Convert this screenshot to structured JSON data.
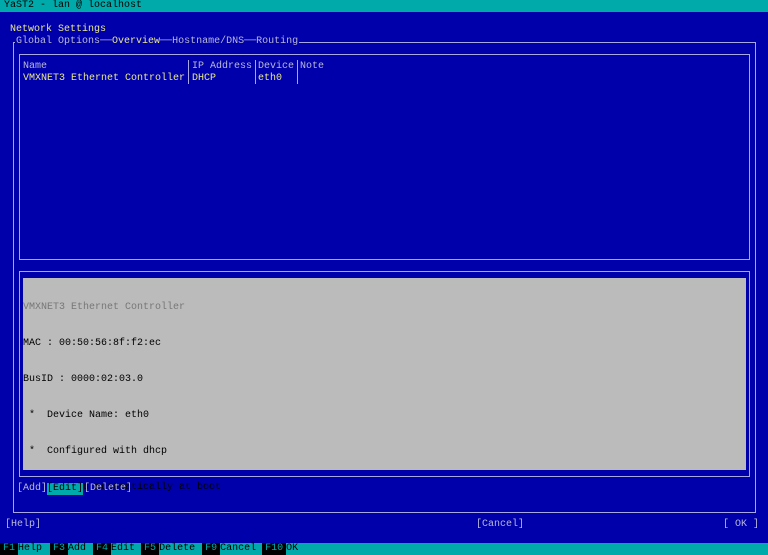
{
  "window_title": "YaST2 - lan @ localhost",
  "dialog_title": "Network Settings",
  "tabs": [
    {
      "label": "Global Options",
      "active": false
    },
    {
      "label": "Overview",
      "active": true
    },
    {
      "label": "Hostname/DNS",
      "active": false
    },
    {
      "label": "Routing",
      "active": false
    }
  ],
  "table": {
    "columns": [
      "Name",
      "IP Address",
      "Device",
      "Note"
    ],
    "rows": [
      [
        "VMXNET3 Ethernet Controller",
        "DHCP",
        "eth0",
        ""
      ]
    ]
  },
  "details": {
    "title": "VMXNET3 Ethernet Controller",
    "mac": "MAC : 00:50:56:8f:f2:ec",
    "busid": "BusID : 0000:02:03.0",
    "bullets": [
      "Device Name: eth0",
      "Configured with dhcp",
      "Started automatically at boot"
    ]
  },
  "buttons": {
    "add": "[Add]",
    "edit": "[Edit]",
    "delete": "[Delete]",
    "help": "[Help]",
    "cancel": "[Cancel]",
    "ok": "[ OK ]"
  },
  "fkeys": [
    {
      "key": "F1",
      "label": "Help"
    },
    {
      "key": "F3",
      "label": "Add"
    },
    {
      "key": "F4",
      "label": "Edit"
    },
    {
      "key": "F5",
      "label": "Delete"
    },
    {
      "key": "F9",
      "label": "Cancel"
    },
    {
      "key": "F10",
      "label": "OK"
    }
  ],
  "colors": {
    "background": "#0000aa",
    "accent": "#00aaaa",
    "detail_bg": "#bbbbbb"
  }
}
